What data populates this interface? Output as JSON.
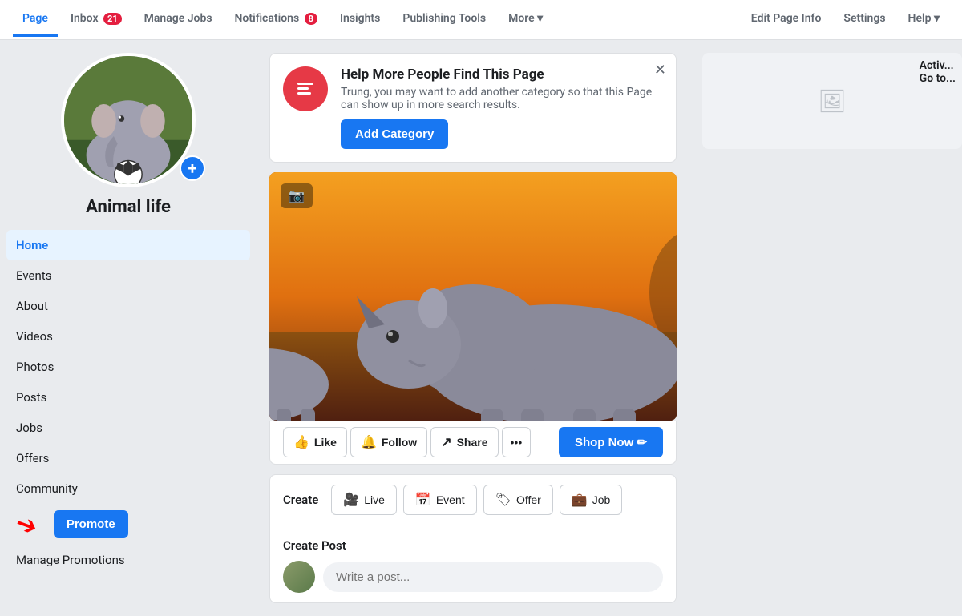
{
  "nav": {
    "items": [
      {
        "id": "page",
        "label": "Page",
        "active": true,
        "badge": null
      },
      {
        "id": "inbox",
        "label": "Inbox",
        "active": false,
        "badge": "21"
      },
      {
        "id": "manage-jobs",
        "label": "Manage Jobs",
        "active": false,
        "badge": null
      },
      {
        "id": "notifications",
        "label": "Notifications",
        "active": false,
        "badge": "8"
      },
      {
        "id": "insights",
        "label": "Insights",
        "active": false,
        "badge": null
      },
      {
        "id": "publishing-tools",
        "label": "Publishing Tools",
        "active": false,
        "badge": null
      },
      {
        "id": "more",
        "label": "More ▾",
        "active": false,
        "badge": null
      }
    ],
    "right_items": [
      {
        "id": "edit-page-info",
        "label": "Edit Page Info"
      },
      {
        "id": "settings",
        "label": "Settings"
      },
      {
        "id": "help",
        "label": "Help ▾"
      }
    ]
  },
  "sidebar": {
    "page_name": "Animal life",
    "nav_items": [
      {
        "id": "home",
        "label": "Home",
        "active": true
      },
      {
        "id": "events",
        "label": "Events",
        "active": false
      },
      {
        "id": "about",
        "label": "About",
        "active": false
      },
      {
        "id": "videos",
        "label": "Videos",
        "active": false
      },
      {
        "id": "photos",
        "label": "Photos",
        "active": false
      },
      {
        "id": "posts",
        "label": "Posts",
        "active": false
      },
      {
        "id": "jobs",
        "label": "Jobs",
        "active": false
      },
      {
        "id": "offers",
        "label": "Offers",
        "active": false
      },
      {
        "id": "community",
        "label": "Community",
        "active": false
      }
    ],
    "promote_label": "Promote",
    "manage_promotions_label": "Manage Promotions"
  },
  "banner": {
    "title": "Help More People Find This Page",
    "description": "Trung, you may want to add another category so that this Page can show up in more search results.",
    "button_label": "Add Category",
    "icon": "🏷"
  },
  "cover": {
    "camera_icon": "📷"
  },
  "actions": {
    "like_label": "Like",
    "follow_label": "Follow",
    "share_label": "Share",
    "shop_now_label": "Shop Now ✏"
  },
  "post_tools": {
    "create_label": "Create",
    "live_label": "Live",
    "event_label": "Event",
    "offer_label": "Offer",
    "job_label": "Job"
  },
  "create_post": {
    "header": "Create Post",
    "placeholder": "Write a post..."
  },
  "right_panel": {
    "icon": "🖼",
    "text": "Activ..."
  }
}
